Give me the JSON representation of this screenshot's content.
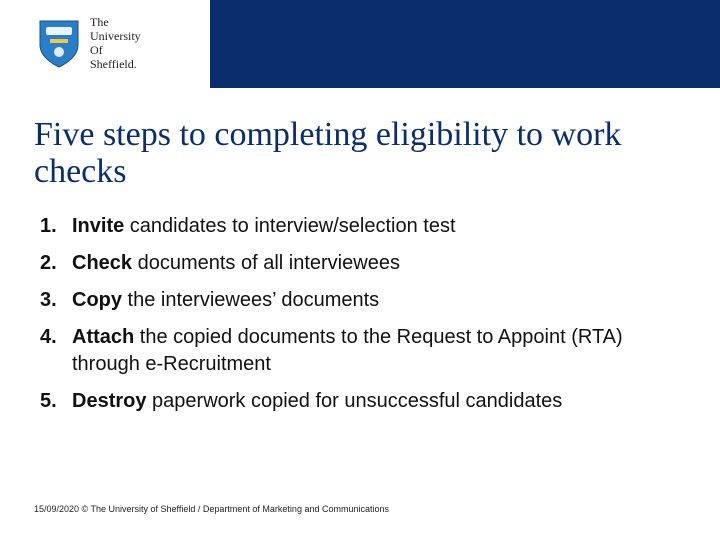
{
  "logo": {
    "line1": "The",
    "line2": "University",
    "line3": "Of",
    "line4": "Sheffield."
  },
  "title": "Five steps to completing eligibility to work checks",
  "steps": [
    {
      "strong": "Invite",
      "rest": " candidates to interview/selection test"
    },
    {
      "strong": "Check",
      "rest": " documents of all interviewees"
    },
    {
      "strong": "Copy",
      "rest": " the interviewees’ documents"
    },
    {
      "strong": "Attach",
      "rest": " the copied documents to the Request to Appoint (RTA) through e-Recruitment"
    },
    {
      "strong": "Destroy",
      "rest": " paperwork copied for unsuccessful candidates"
    }
  ],
  "footer": "15/09/2020 © The University of Sheffield / Department of Marketing and Communications"
}
